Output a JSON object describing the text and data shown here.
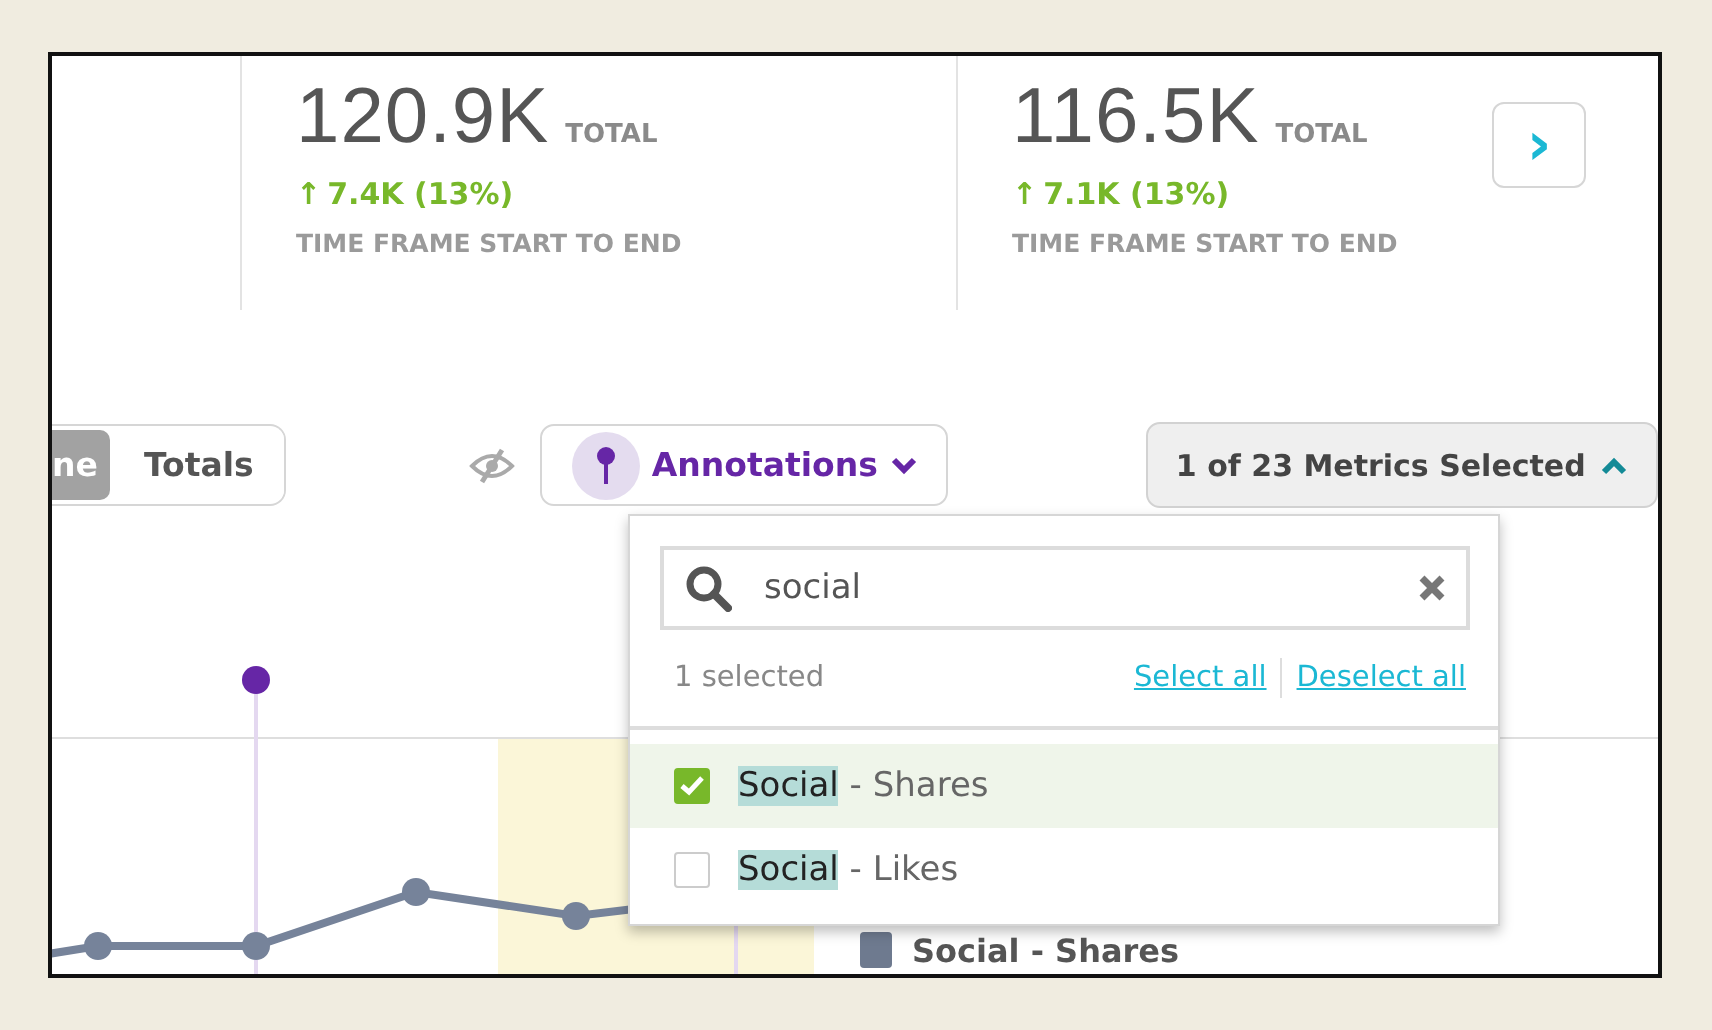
{
  "stats": [
    {
      "value": "120.9K",
      "unit": "TOTAL",
      "change_arrow": "↑",
      "change": "7.4K (13%)",
      "caption": "TIME FRAME START TO END"
    },
    {
      "value": "116.5K",
      "unit": "TOTAL",
      "change_arrow": "↑",
      "change": "7.1K (13%)",
      "caption": "TIME FRAME START TO END"
    }
  ],
  "next_button": {
    "label": "›"
  },
  "view_toggle": [
    {
      "label": "ne",
      "selected": true
    },
    {
      "label": "Totals",
      "selected": false
    }
  ],
  "annotations_button": {
    "label": "Annotations"
  },
  "metrics_dropdown": {
    "label": "1 of 23 Metrics Selected",
    "expanded": true,
    "search": {
      "value": "social"
    },
    "selected_count": "1 selected",
    "select_all": "Select all",
    "deselect_all": "Deselect all",
    "options": [
      {
        "match": "Social",
        "rest": " - Shares",
        "checked": true
      },
      {
        "match": "Social",
        "rest": " - Likes",
        "checked": false
      }
    ]
  },
  "legend": [
    {
      "label": "Social - Shares",
      "color": "#6e7a8f"
    }
  ]
}
